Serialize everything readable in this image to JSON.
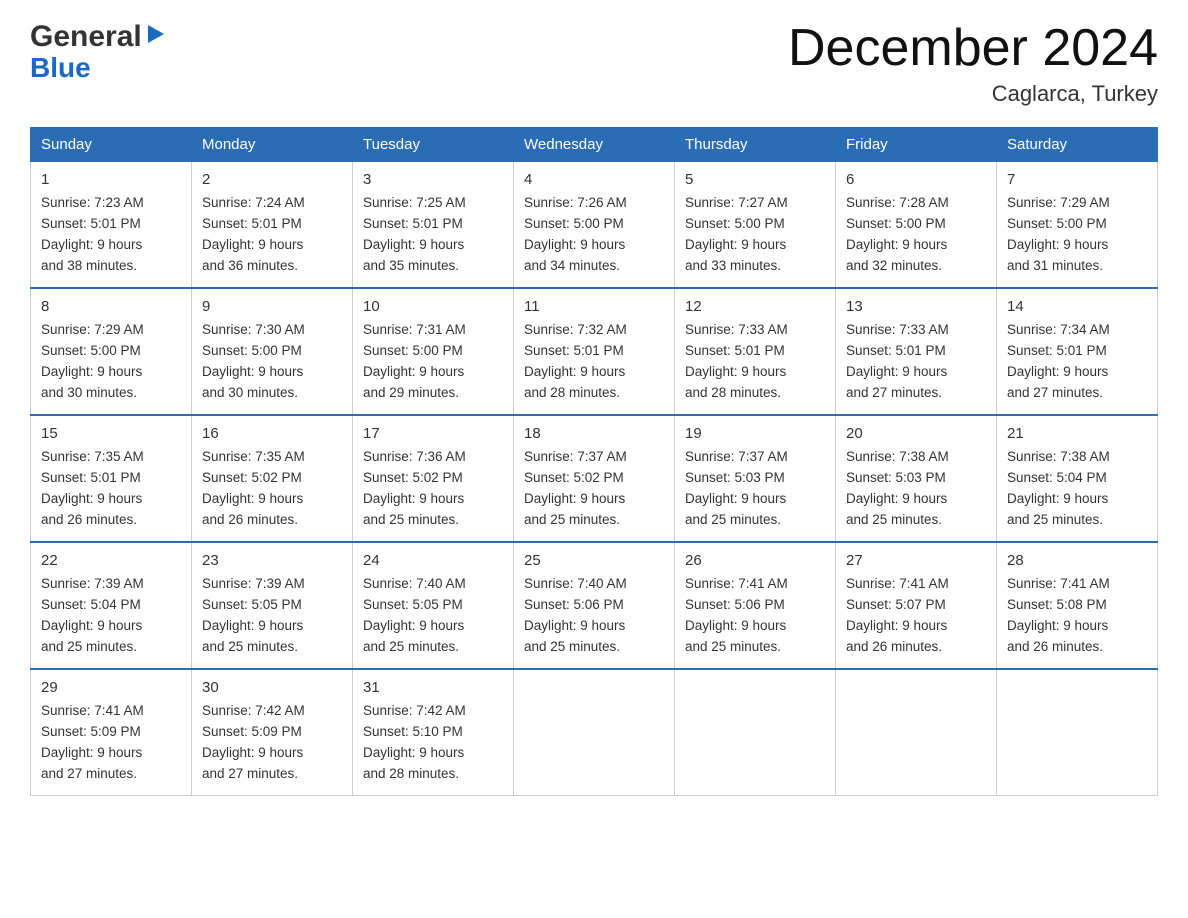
{
  "logo": {
    "general": "General",
    "blue": "Blue",
    "arrow": "▶"
  },
  "title": "December 2024",
  "location": "Caglarca, Turkey",
  "weekdays": [
    "Sunday",
    "Monday",
    "Tuesday",
    "Wednesday",
    "Thursday",
    "Friday",
    "Saturday"
  ],
  "weeks": [
    [
      {
        "day": "1",
        "sunrise": "7:23 AM",
        "sunset": "5:01 PM",
        "daylight": "9 hours and 38 minutes."
      },
      {
        "day": "2",
        "sunrise": "7:24 AM",
        "sunset": "5:01 PM",
        "daylight": "9 hours and 36 minutes."
      },
      {
        "day": "3",
        "sunrise": "7:25 AM",
        "sunset": "5:01 PM",
        "daylight": "9 hours and 35 minutes."
      },
      {
        "day": "4",
        "sunrise": "7:26 AM",
        "sunset": "5:00 PM",
        "daylight": "9 hours and 34 minutes."
      },
      {
        "day": "5",
        "sunrise": "7:27 AM",
        "sunset": "5:00 PM",
        "daylight": "9 hours and 33 minutes."
      },
      {
        "day": "6",
        "sunrise": "7:28 AM",
        "sunset": "5:00 PM",
        "daylight": "9 hours and 32 minutes."
      },
      {
        "day": "7",
        "sunrise": "7:29 AM",
        "sunset": "5:00 PM",
        "daylight": "9 hours and 31 minutes."
      }
    ],
    [
      {
        "day": "8",
        "sunrise": "7:29 AM",
        "sunset": "5:00 PM",
        "daylight": "9 hours and 30 minutes."
      },
      {
        "day": "9",
        "sunrise": "7:30 AM",
        "sunset": "5:00 PM",
        "daylight": "9 hours and 30 minutes."
      },
      {
        "day": "10",
        "sunrise": "7:31 AM",
        "sunset": "5:00 PM",
        "daylight": "9 hours and 29 minutes."
      },
      {
        "day": "11",
        "sunrise": "7:32 AM",
        "sunset": "5:01 PM",
        "daylight": "9 hours and 28 minutes."
      },
      {
        "day": "12",
        "sunrise": "7:33 AM",
        "sunset": "5:01 PM",
        "daylight": "9 hours and 28 minutes."
      },
      {
        "day": "13",
        "sunrise": "7:33 AM",
        "sunset": "5:01 PM",
        "daylight": "9 hours and 27 minutes."
      },
      {
        "day": "14",
        "sunrise": "7:34 AM",
        "sunset": "5:01 PM",
        "daylight": "9 hours and 27 minutes."
      }
    ],
    [
      {
        "day": "15",
        "sunrise": "7:35 AM",
        "sunset": "5:01 PM",
        "daylight": "9 hours and 26 minutes."
      },
      {
        "day": "16",
        "sunrise": "7:35 AM",
        "sunset": "5:02 PM",
        "daylight": "9 hours and 26 minutes."
      },
      {
        "day": "17",
        "sunrise": "7:36 AM",
        "sunset": "5:02 PM",
        "daylight": "9 hours and 25 minutes."
      },
      {
        "day": "18",
        "sunrise": "7:37 AM",
        "sunset": "5:02 PM",
        "daylight": "9 hours and 25 minutes."
      },
      {
        "day": "19",
        "sunrise": "7:37 AM",
        "sunset": "5:03 PM",
        "daylight": "9 hours and 25 minutes."
      },
      {
        "day": "20",
        "sunrise": "7:38 AM",
        "sunset": "5:03 PM",
        "daylight": "9 hours and 25 minutes."
      },
      {
        "day": "21",
        "sunrise": "7:38 AM",
        "sunset": "5:04 PM",
        "daylight": "9 hours and 25 minutes."
      }
    ],
    [
      {
        "day": "22",
        "sunrise": "7:39 AM",
        "sunset": "5:04 PM",
        "daylight": "9 hours and 25 minutes."
      },
      {
        "day": "23",
        "sunrise": "7:39 AM",
        "sunset": "5:05 PM",
        "daylight": "9 hours and 25 minutes."
      },
      {
        "day": "24",
        "sunrise": "7:40 AM",
        "sunset": "5:05 PM",
        "daylight": "9 hours and 25 minutes."
      },
      {
        "day": "25",
        "sunrise": "7:40 AM",
        "sunset": "5:06 PM",
        "daylight": "9 hours and 25 minutes."
      },
      {
        "day": "26",
        "sunrise": "7:41 AM",
        "sunset": "5:06 PM",
        "daylight": "9 hours and 25 minutes."
      },
      {
        "day": "27",
        "sunrise": "7:41 AM",
        "sunset": "5:07 PM",
        "daylight": "9 hours and 26 minutes."
      },
      {
        "day": "28",
        "sunrise": "7:41 AM",
        "sunset": "5:08 PM",
        "daylight": "9 hours and 26 minutes."
      }
    ],
    [
      {
        "day": "29",
        "sunrise": "7:41 AM",
        "sunset": "5:09 PM",
        "daylight": "9 hours and 27 minutes."
      },
      {
        "day": "30",
        "sunrise": "7:42 AM",
        "sunset": "5:09 PM",
        "daylight": "9 hours and 27 minutes."
      },
      {
        "day": "31",
        "sunrise": "7:42 AM",
        "sunset": "5:10 PM",
        "daylight": "9 hours and 28 minutes."
      },
      null,
      null,
      null,
      null
    ]
  ],
  "labels": {
    "sunrise": "Sunrise:",
    "sunset": "Sunset:",
    "daylight": "Daylight:"
  }
}
